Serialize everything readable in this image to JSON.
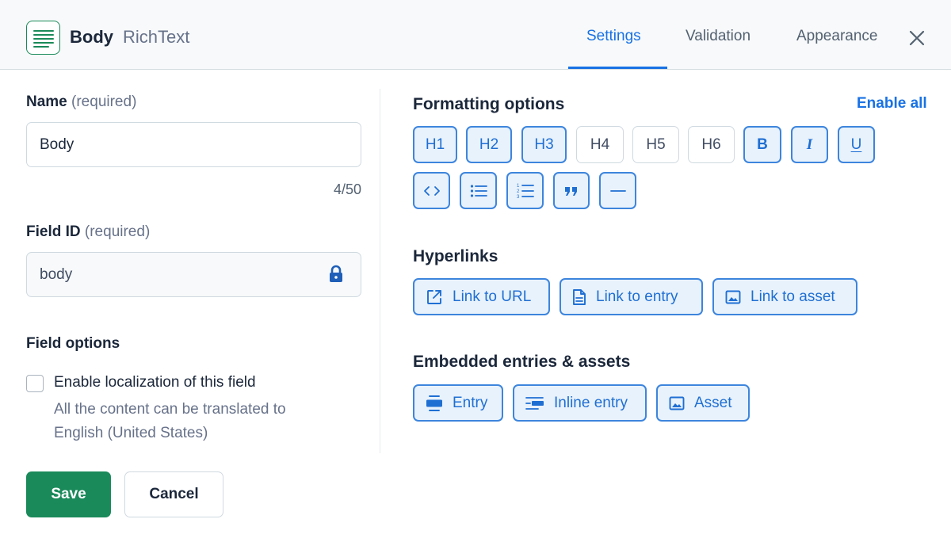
{
  "header": {
    "field_name": "Body",
    "field_type": "RichText",
    "tabs": [
      {
        "label": "Settings",
        "active": true
      },
      {
        "label": "Validation",
        "active": false
      },
      {
        "label": "Appearance",
        "active": false
      }
    ],
    "close_icon": "close-icon"
  },
  "form": {
    "name": {
      "label": "Name",
      "required_note": "(required)",
      "value": "Body",
      "counter": "4/50"
    },
    "field_id": {
      "label": "Field ID",
      "required_note": "(required)",
      "value": "body",
      "icon": "lock-icon"
    },
    "field_options": {
      "title": "Field options",
      "localization_label": "Enable localization of this field",
      "localization_help": "All the content can be translated to English (United States)",
      "localization_checked": false
    }
  },
  "actions": {
    "save_label": "Save",
    "cancel_label": "Cancel"
  },
  "formatting": {
    "title": "Formatting options",
    "enable_all": "Enable all",
    "toggles": [
      {
        "label": "H1",
        "on": true
      },
      {
        "label": "H2",
        "on": true
      },
      {
        "label": "H3",
        "on": true
      },
      {
        "label": "H4",
        "on": false
      },
      {
        "label": "H5",
        "on": false
      },
      {
        "label": "H6",
        "on": false
      },
      {
        "label": "B",
        "icon": "bold-icon",
        "on": true
      },
      {
        "label": "I",
        "icon": "italic-icon",
        "on": true
      },
      {
        "label": "U",
        "icon": "underline-icon",
        "on": true
      },
      {
        "icon": "code-icon",
        "on": true
      },
      {
        "icon": "bulleted-list-icon",
        "on": true
      },
      {
        "icon": "numbered-list-icon",
        "on": true
      },
      {
        "icon": "quote-icon",
        "on": true
      },
      {
        "icon": "horizontal-rule-icon",
        "on": true
      }
    ]
  },
  "hyperlinks": {
    "title": "Hyperlinks",
    "items": [
      {
        "label": "Link to URL",
        "icon": "external-link-icon"
      },
      {
        "label": "Link to entry",
        "icon": "document-icon"
      },
      {
        "label": "Link to asset",
        "icon": "image-icon"
      }
    ]
  },
  "embedded": {
    "title": "Embedded entries & assets",
    "items": [
      {
        "label": "Entry",
        "icon": "block-entry-icon"
      },
      {
        "label": "Inline entry",
        "icon": "inline-entry-icon"
      },
      {
        "label": "Asset",
        "icon": "image-icon"
      }
    ]
  },
  "colors": {
    "accent": "#1872e5",
    "brand": "#1a8a5a",
    "text": "#1b273a",
    "muted": "#67728a"
  }
}
